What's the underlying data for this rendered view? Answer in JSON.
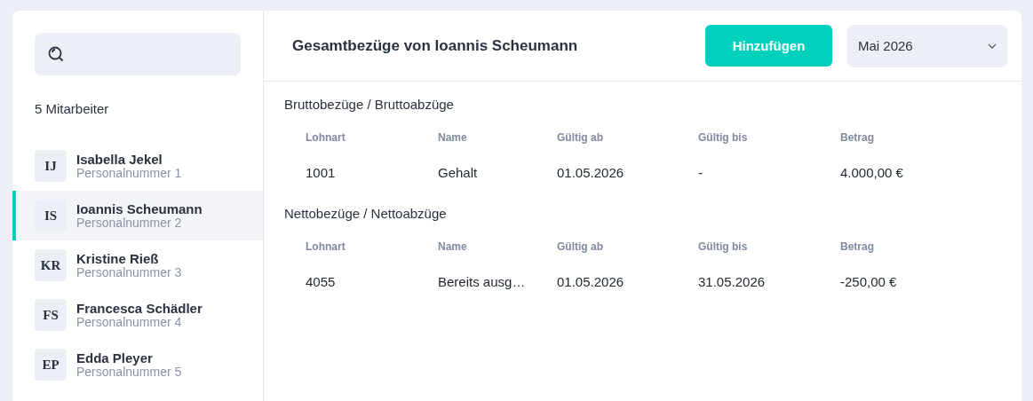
{
  "sidebar": {
    "count": "5 Mitarbeiter",
    "employees": [
      {
        "initials": "IJ",
        "name": "Isabella Jekel",
        "number": "Personalnummer 1",
        "selected": false
      },
      {
        "initials": "IS",
        "name": "Ioannis Scheumann",
        "number": "Personalnummer 2",
        "selected": true
      },
      {
        "initials": "KR",
        "name": "Kristine Rieß",
        "number": "Personalnummer 3",
        "selected": false
      },
      {
        "initials": "FS",
        "name": "Francesca Schädler",
        "number": "Personalnummer 4",
        "selected": false
      },
      {
        "initials": "EP",
        "name": "Edda Pleyer",
        "number": "Personalnummer 5",
        "selected": false
      }
    ]
  },
  "header": {
    "title": "Gesamtbezüge von Ioannis Scheumann",
    "add_button": "Hinzufügen",
    "month_select": "Mai 2026"
  },
  "sections": [
    {
      "title": "Bruttobezüge / Bruttoabzüge",
      "columns": [
        "Lohnart",
        "Name",
        "Gültig ab",
        "Gültig bis",
        "Betrag"
      ],
      "rows": [
        [
          "1001",
          "Gehalt",
          "01.05.2026",
          "-",
          "4.000,00 €"
        ]
      ]
    },
    {
      "title": "Nettobezüge / Nettoabzüge",
      "columns": [
        "Lohnart",
        "Name",
        "Gültig ab",
        "Gültig bis",
        "Betrag"
      ],
      "rows": [
        [
          "4055",
          "Bereits ausg…",
          "01.05.2026",
          "31.05.2026",
          "-250,00 €"
        ]
      ]
    }
  ]
}
